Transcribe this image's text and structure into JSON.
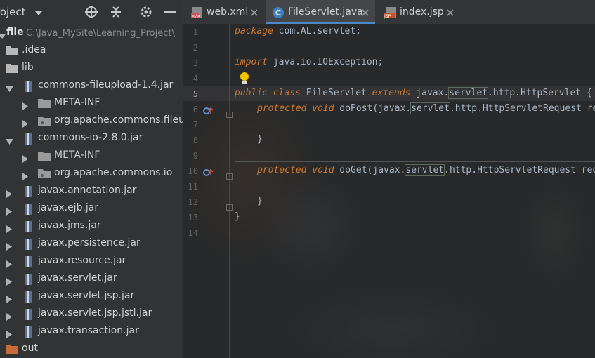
{
  "project_panel": {
    "title": "roject",
    "root": {
      "name": "file",
      "path": "C:\\Java_MySite\\Learning_Project\\"
    },
    "items": [
      {
        "label": ".idea"
      },
      {
        "label": "lib"
      },
      {
        "label": "commons-fileupload-1.4.jar"
      },
      {
        "label": "META-INF"
      },
      {
        "label": "org.apache.commons.fileup"
      },
      {
        "label": "commons-io-2.8.0.jar"
      },
      {
        "label": "META-INF"
      },
      {
        "label": "org.apache.commons.io"
      },
      {
        "label": "javax.annotation.jar"
      },
      {
        "label": "javax.ejb.jar"
      },
      {
        "label": "javax.jms.jar"
      },
      {
        "label": "javax.persistence.jar"
      },
      {
        "label": "javax.resource.jar"
      },
      {
        "label": "javax.servlet.jar"
      },
      {
        "label": "javax.servlet.jsp.jar"
      },
      {
        "label": "javax.servlet.jsp.jstl.jar"
      },
      {
        "label": "javax.transaction.jar"
      },
      {
        "label": "out"
      }
    ]
  },
  "tabs": [
    {
      "label": "web.xml"
    },
    {
      "label": "FileServlet.java"
    },
    {
      "label": "index.jsp"
    }
  ],
  "editor": {
    "line_numbers": [
      "1",
      "2",
      "3",
      "4",
      "5",
      "6",
      "7",
      "8",
      "9",
      "10",
      "11",
      "12",
      "13",
      "14"
    ],
    "code": {
      "l1_kw": "package",
      "l1_rest": " com.AL.servlet;",
      "l3_kw": "import",
      "l3_rest": " java.io.IOException;",
      "l5_kw1": "public class",
      "l5_name": " FileServlet ",
      "l5_kw2": "extends",
      "l5_pre": " javax.",
      "l5_box": "servlet",
      "l5_post": ".http.HttpServlet {",
      "l6_kw": "protected void",
      "l6_name": " doPost(javax.",
      "l6_box": "servlet",
      "l6_post": ".http.HttpServletRequest req",
      "l8": "}",
      "l10_kw": "protected void",
      "l10_name": " doGet(javax.",
      "l10_box": "servlet",
      "l10_post": ".http.HttpServletRequest req",
      "l12": "}",
      "l13": "}"
    }
  },
  "colors": {
    "keyword": "#cc7832",
    "text": "#a9b7c6",
    "accent": "#4a88c7"
  }
}
